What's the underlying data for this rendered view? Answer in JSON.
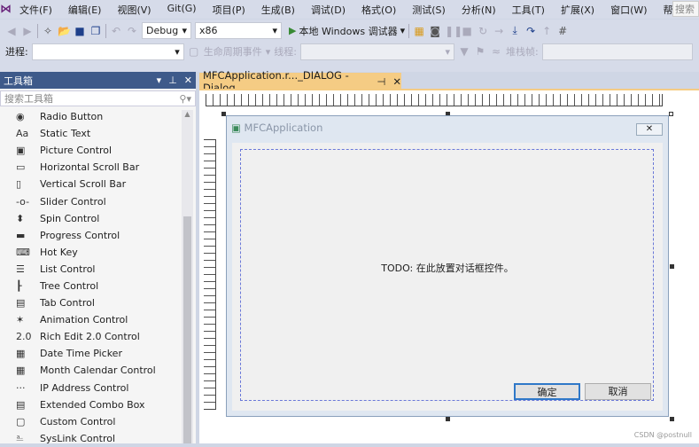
{
  "menu": [
    "文件(F)",
    "编辑(E)",
    "视图(V)",
    "Git(G)",
    "项目(P)",
    "生成(B)",
    "调试(D)",
    "格式(O)",
    "测试(S)",
    "分析(N)",
    "工具(T)",
    "扩展(X)",
    "窗口(W)",
    "帮助(H)"
  ],
  "search_placeholder": "搜索",
  "toolbar": {
    "config": "Debug",
    "platform": "x86",
    "run": "本地 Windows 调试器"
  },
  "toolbar2": {
    "process_label": "进程:",
    "lifecycle": "生命周期事件",
    "thread_label": "线程:",
    "stack_label": "堆栈帧:"
  },
  "toolbox": {
    "title": "工具箱",
    "search_placeholder": "搜索工具箱",
    "items": [
      {
        "g": "◉",
        "label": "Radio Button"
      },
      {
        "g": "Aa",
        "label": "Static Text"
      },
      {
        "g": "▣",
        "label": "Picture Control"
      },
      {
        "g": "▭",
        "label": "Horizontal Scroll Bar"
      },
      {
        "g": "▯",
        "label": "Vertical Scroll Bar"
      },
      {
        "g": "-o-",
        "label": "Slider Control"
      },
      {
        "g": "⬍",
        "label": "Spin Control"
      },
      {
        "g": "▬",
        "label": "Progress Control"
      },
      {
        "g": "⌨",
        "label": "Hot Key"
      },
      {
        "g": "☰",
        "label": "List Control"
      },
      {
        "g": "┠",
        "label": "Tree Control"
      },
      {
        "g": "▤",
        "label": "Tab Control"
      },
      {
        "g": "✶",
        "label": "Animation Control"
      },
      {
        "g": "2.0",
        "label": "Rich Edit 2.0 Control"
      },
      {
        "g": "▦",
        "label": "Date Time Picker"
      },
      {
        "g": "▦",
        "label": "Month Calendar Control"
      },
      {
        "g": "···",
        "label": "IP Address Control"
      },
      {
        "g": "▤",
        "label": "Extended Combo Box"
      },
      {
        "g": "▢",
        "label": "Custom Control"
      },
      {
        "g": "⎁",
        "label": "SysLink Control"
      }
    ]
  },
  "tab": {
    "title": "MFCApplication.r..._DIALOG - Dialog"
  },
  "dialog": {
    "title": "MFCApplication",
    "todo": "TODO: 在此放置对话框控件。",
    "ok": "确定",
    "cancel": "取消"
  },
  "watermark": "CSDN @postnull"
}
